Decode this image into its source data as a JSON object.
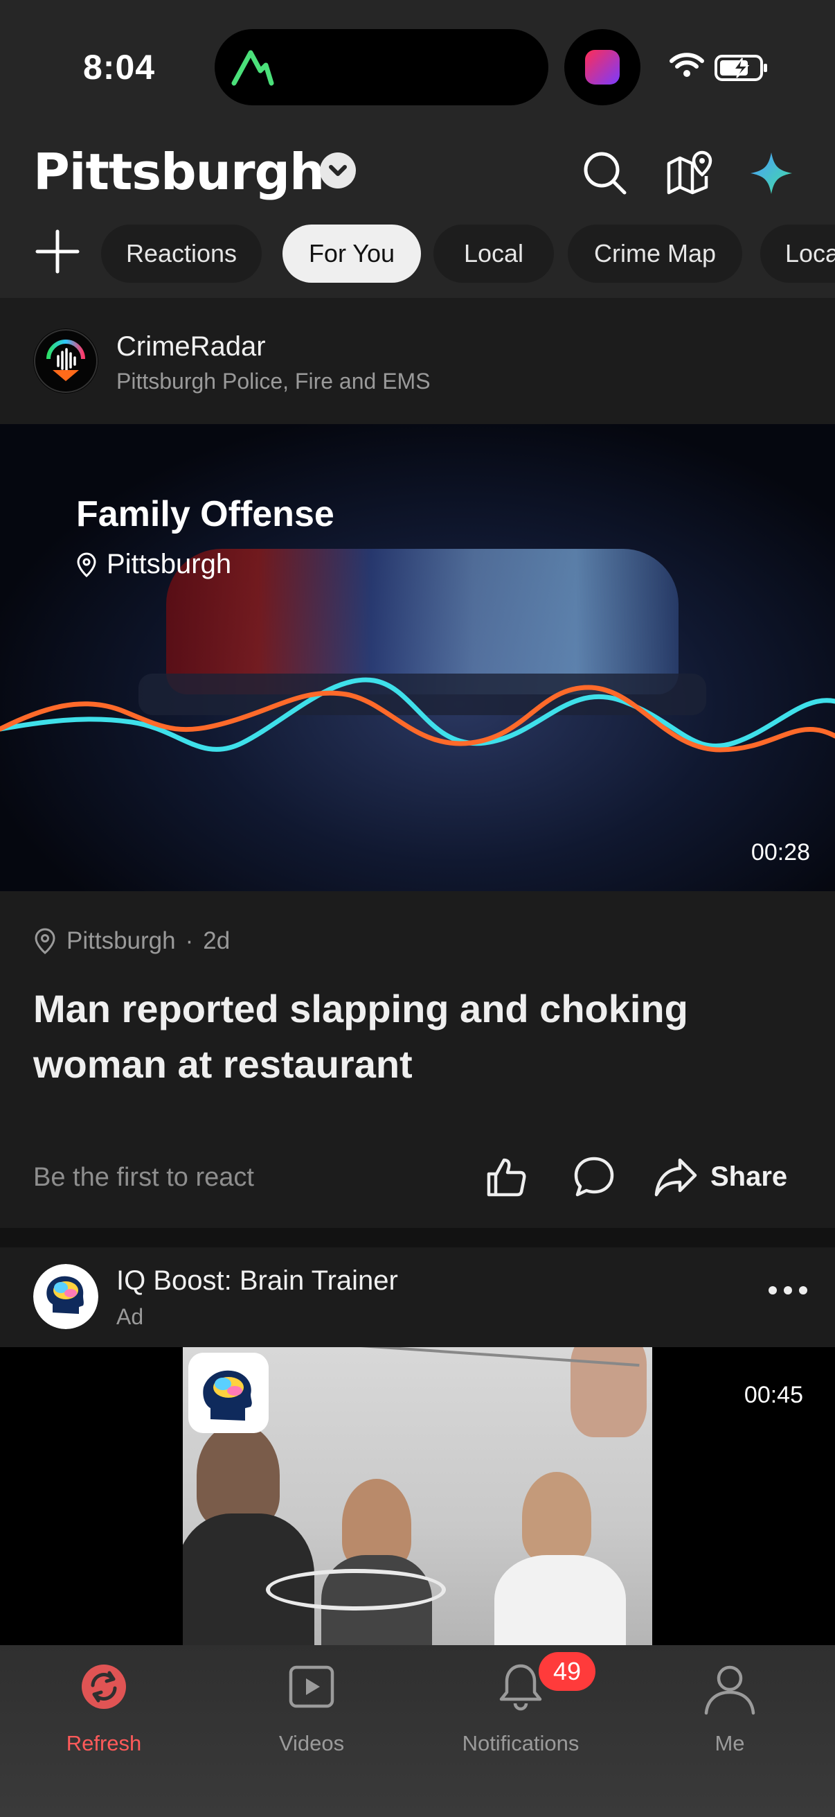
{
  "status": {
    "time": "8:04"
  },
  "header": {
    "city": "Pittsburgh",
    "tabs": [
      "Reactions",
      "For You",
      "Local",
      "Crime Map",
      "Local"
    ],
    "active_tab": "For You"
  },
  "post1": {
    "source_name": "CrimeRadar",
    "source_sub": "Pittsburgh Police, Fire and EMS",
    "video_title": "Family Offense",
    "video_location": "Pittsburgh",
    "video_duration": "00:28",
    "location": "Pittsburgh",
    "dot": "·",
    "age": "2d",
    "headline": "Man reported slapping and choking woman at restaurant",
    "react_prompt": "Be the first to react",
    "share_label": "Share"
  },
  "post2": {
    "advertiser": "IQ Boost: Brain Trainer",
    "ad_label": "Ad",
    "video_duration": "00:45"
  },
  "nav": {
    "items": [
      {
        "label": "Refresh",
        "icon": "refresh-icon"
      },
      {
        "label": "Videos",
        "icon": "video-icon"
      },
      {
        "label": "Notifications",
        "icon": "bell-icon"
      },
      {
        "label": "Me",
        "icon": "person-icon"
      }
    ],
    "notifications_badge": "49"
  },
  "colors": {
    "accent": "#ff5a5a",
    "badge": "#ff3b3b",
    "wave_cyan": "#3fe0ea",
    "wave_orange": "#ff6a2a"
  }
}
